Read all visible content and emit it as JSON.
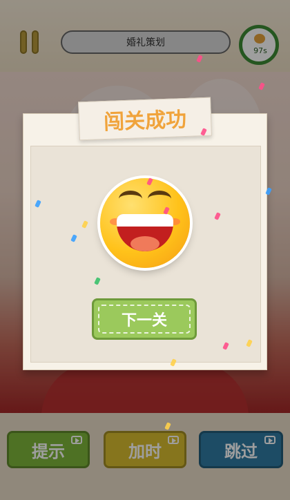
{
  "header": {
    "level_title": "婚礼策划",
    "timer_text": "97s"
  },
  "dialog": {
    "title": "闯关成功",
    "next_button_label": "下一关"
  },
  "footer_buttons": {
    "hint_label": "提示",
    "add_time_label": "加时",
    "skip_label": "跳过"
  },
  "colors": {
    "panel_bg": "#f7f2e8",
    "title_text": "#f0a33b",
    "next_button": "#9bc95c",
    "hint_button": "#7fb73a",
    "add_time_button": "#d8bd2f",
    "skip_button": "#2f7ba3",
    "timer_ring": "#3c8b35"
  },
  "icons": {
    "pause": "pause-icon",
    "timer": "clock-icon",
    "video": "video-icon",
    "emoji": "laughing-face-icon"
  }
}
